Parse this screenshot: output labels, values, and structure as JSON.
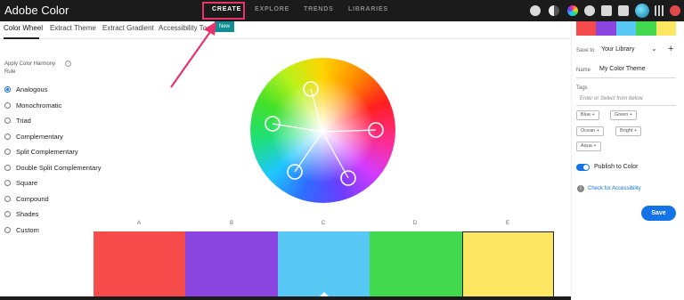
{
  "app": {
    "title": "Adobe Color"
  },
  "nav": {
    "tabs": [
      {
        "label": "CREATE",
        "active": true
      },
      {
        "label": "EXPLORE"
      },
      {
        "label": "TRENDS"
      },
      {
        "label": "LIBRARIES"
      }
    ]
  },
  "toolbar_icons": [
    "settings-icon",
    "contrast-icon",
    "help-icon",
    "notifications-icon",
    "chat-icon",
    "avatar",
    "apps-grid-icon",
    "creative-cloud-icon"
  ],
  "subtabs": [
    {
      "label": "Color Wheel",
      "active": true
    },
    {
      "label": "Extract Theme"
    },
    {
      "label": "Extract Gradient"
    },
    {
      "label": "Accessibility Tools"
    }
  ],
  "new_badge": "New",
  "harmony": {
    "title": "Apply Color Harmony Rule",
    "rules": [
      "Analogous",
      "Monochromatic",
      "Triad",
      "Complementary",
      "Split Complementary",
      "Double Split Complementary",
      "Square",
      "Compound",
      "Shades",
      "Custom"
    ],
    "selected": "Analogous"
  },
  "columns": [
    "A",
    "B",
    "C",
    "D",
    "E"
  ],
  "swatches": [
    "#f64b4b",
    "#8a44e0",
    "#58c8f5",
    "#43d94e",
    "#fde662"
  ],
  "right_panel": {
    "save_to_label": "Save to",
    "library": "Your Library",
    "name_label": "Name",
    "name_value": "My Color Theme",
    "tags_label": "Tags",
    "tags_placeholder": "Enter or Select from below",
    "tags": [
      "Blue",
      "Green",
      "Ocean",
      "Bright",
      "Aqua"
    ],
    "publish_label": "Publish to Color",
    "publish_on": true,
    "accessibility_link": "Check for Accessibility",
    "save_button": "Save"
  },
  "colors": {
    "accent": "#1473e6",
    "highlight": "#e8336d",
    "badge": "#0f8f93"
  }
}
